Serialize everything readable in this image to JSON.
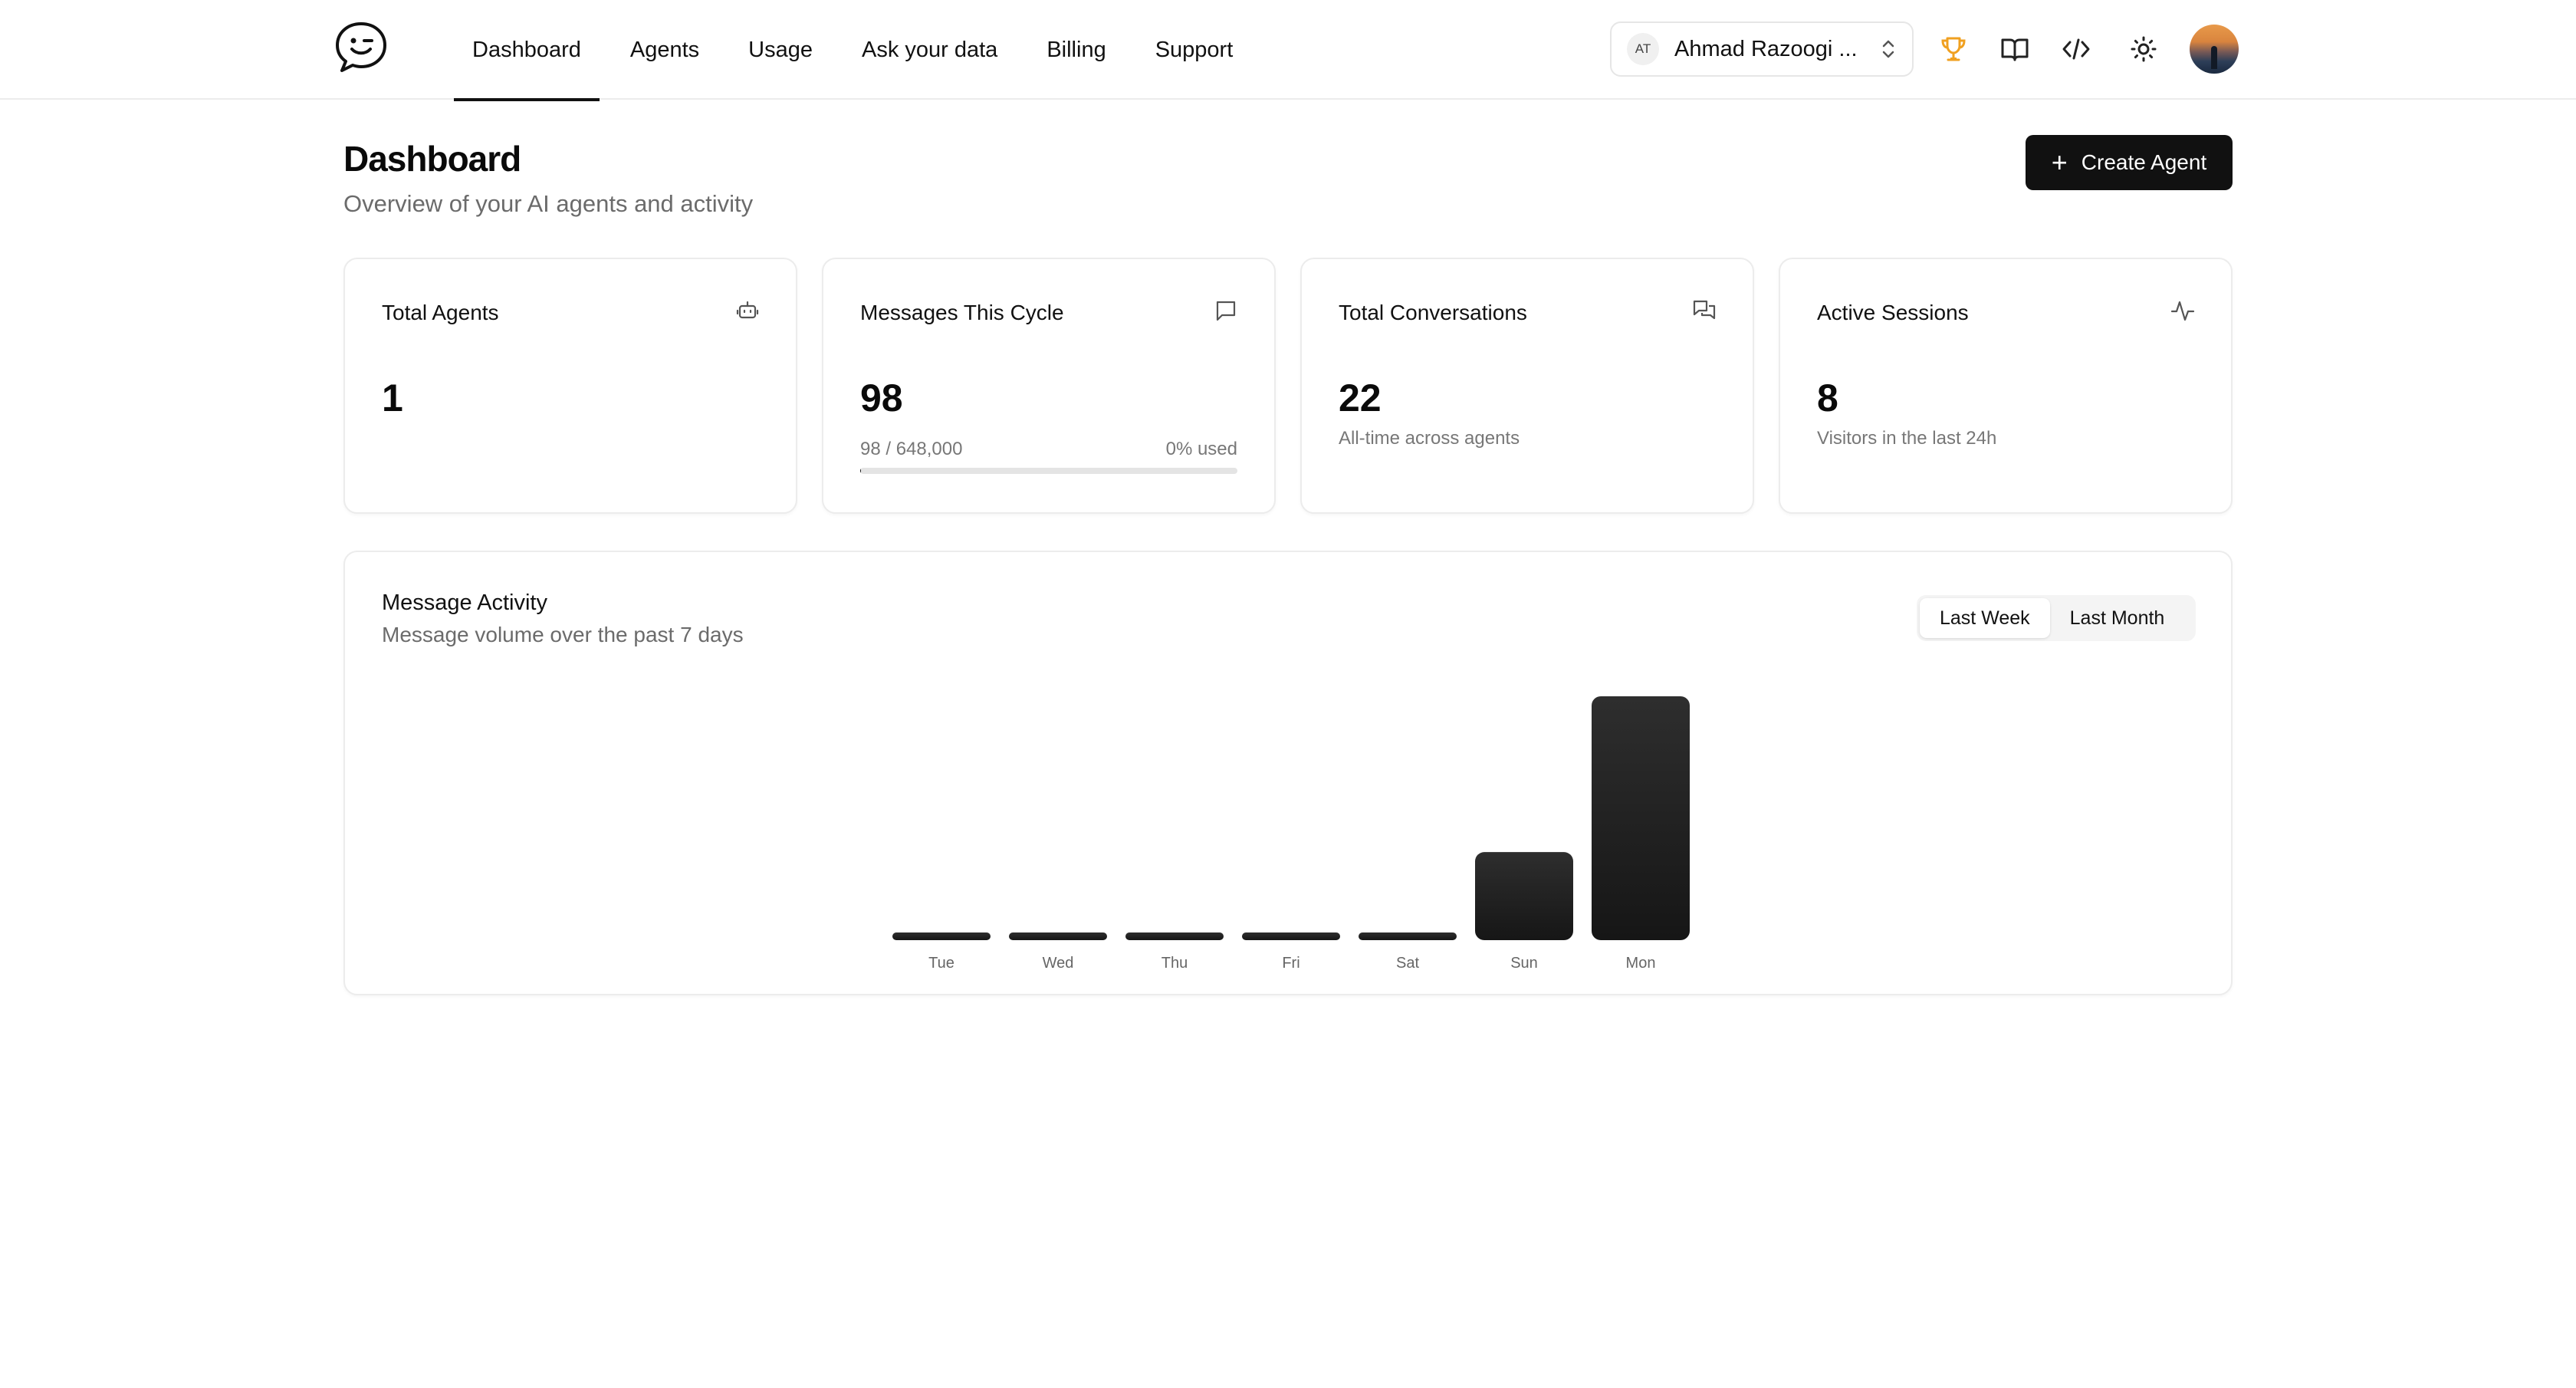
{
  "nav": {
    "items": [
      {
        "label": "Dashboard",
        "active": true
      },
      {
        "label": "Agents",
        "active": false
      },
      {
        "label": "Usage",
        "active": false
      },
      {
        "label": "Ask your data",
        "active": false
      },
      {
        "label": "Billing",
        "active": false
      },
      {
        "label": "Support",
        "active": false
      }
    ]
  },
  "workspace": {
    "initials": "AT",
    "name": "Ahmad Razoogi ..."
  },
  "header_icons": [
    "trophy-icon",
    "book-icon",
    "code-icon",
    "sun-icon"
  ],
  "colors": {
    "accent": "#111111",
    "trophy": "#f0a020",
    "muted": "#6b6b6b"
  },
  "page": {
    "title": "Dashboard",
    "subtitle": "Overview of your AI agents and activity",
    "create_label": "Create Agent"
  },
  "stats": {
    "agents": {
      "title": "Total Agents",
      "value": "1",
      "icon": "bot-icon"
    },
    "messages": {
      "title": "Messages This Cycle",
      "value": "98",
      "usage": "98 / 648,000",
      "used": "0% used",
      "fraction": 0.0002,
      "icon": "message-icon"
    },
    "conversations": {
      "title": "Total Conversations",
      "value": "22",
      "note": "All-time across agents",
      "icon": "messages-icon"
    },
    "sessions": {
      "title": "Active Sessions",
      "value": "8",
      "note": "Visitors in the last 24h",
      "icon": "activity-icon"
    }
  },
  "activity": {
    "title": "Message Activity",
    "subtitle": "Message volume over the past 7 days",
    "range_options": [
      {
        "label": "Last Week",
        "selected": true
      },
      {
        "label": "Last Month",
        "selected": false
      }
    ]
  },
  "chart_data": {
    "type": "bar",
    "categories": [
      "Tue",
      "Wed",
      "Thu",
      "Fri",
      "Sat",
      "Sun",
      "Mon"
    ],
    "values": [
      0,
      0,
      0,
      0,
      0,
      26,
      72
    ],
    "ylim": [
      0,
      72
    ],
    "grid": false,
    "title": "",
    "xlabel": "",
    "ylabel": ""
  }
}
